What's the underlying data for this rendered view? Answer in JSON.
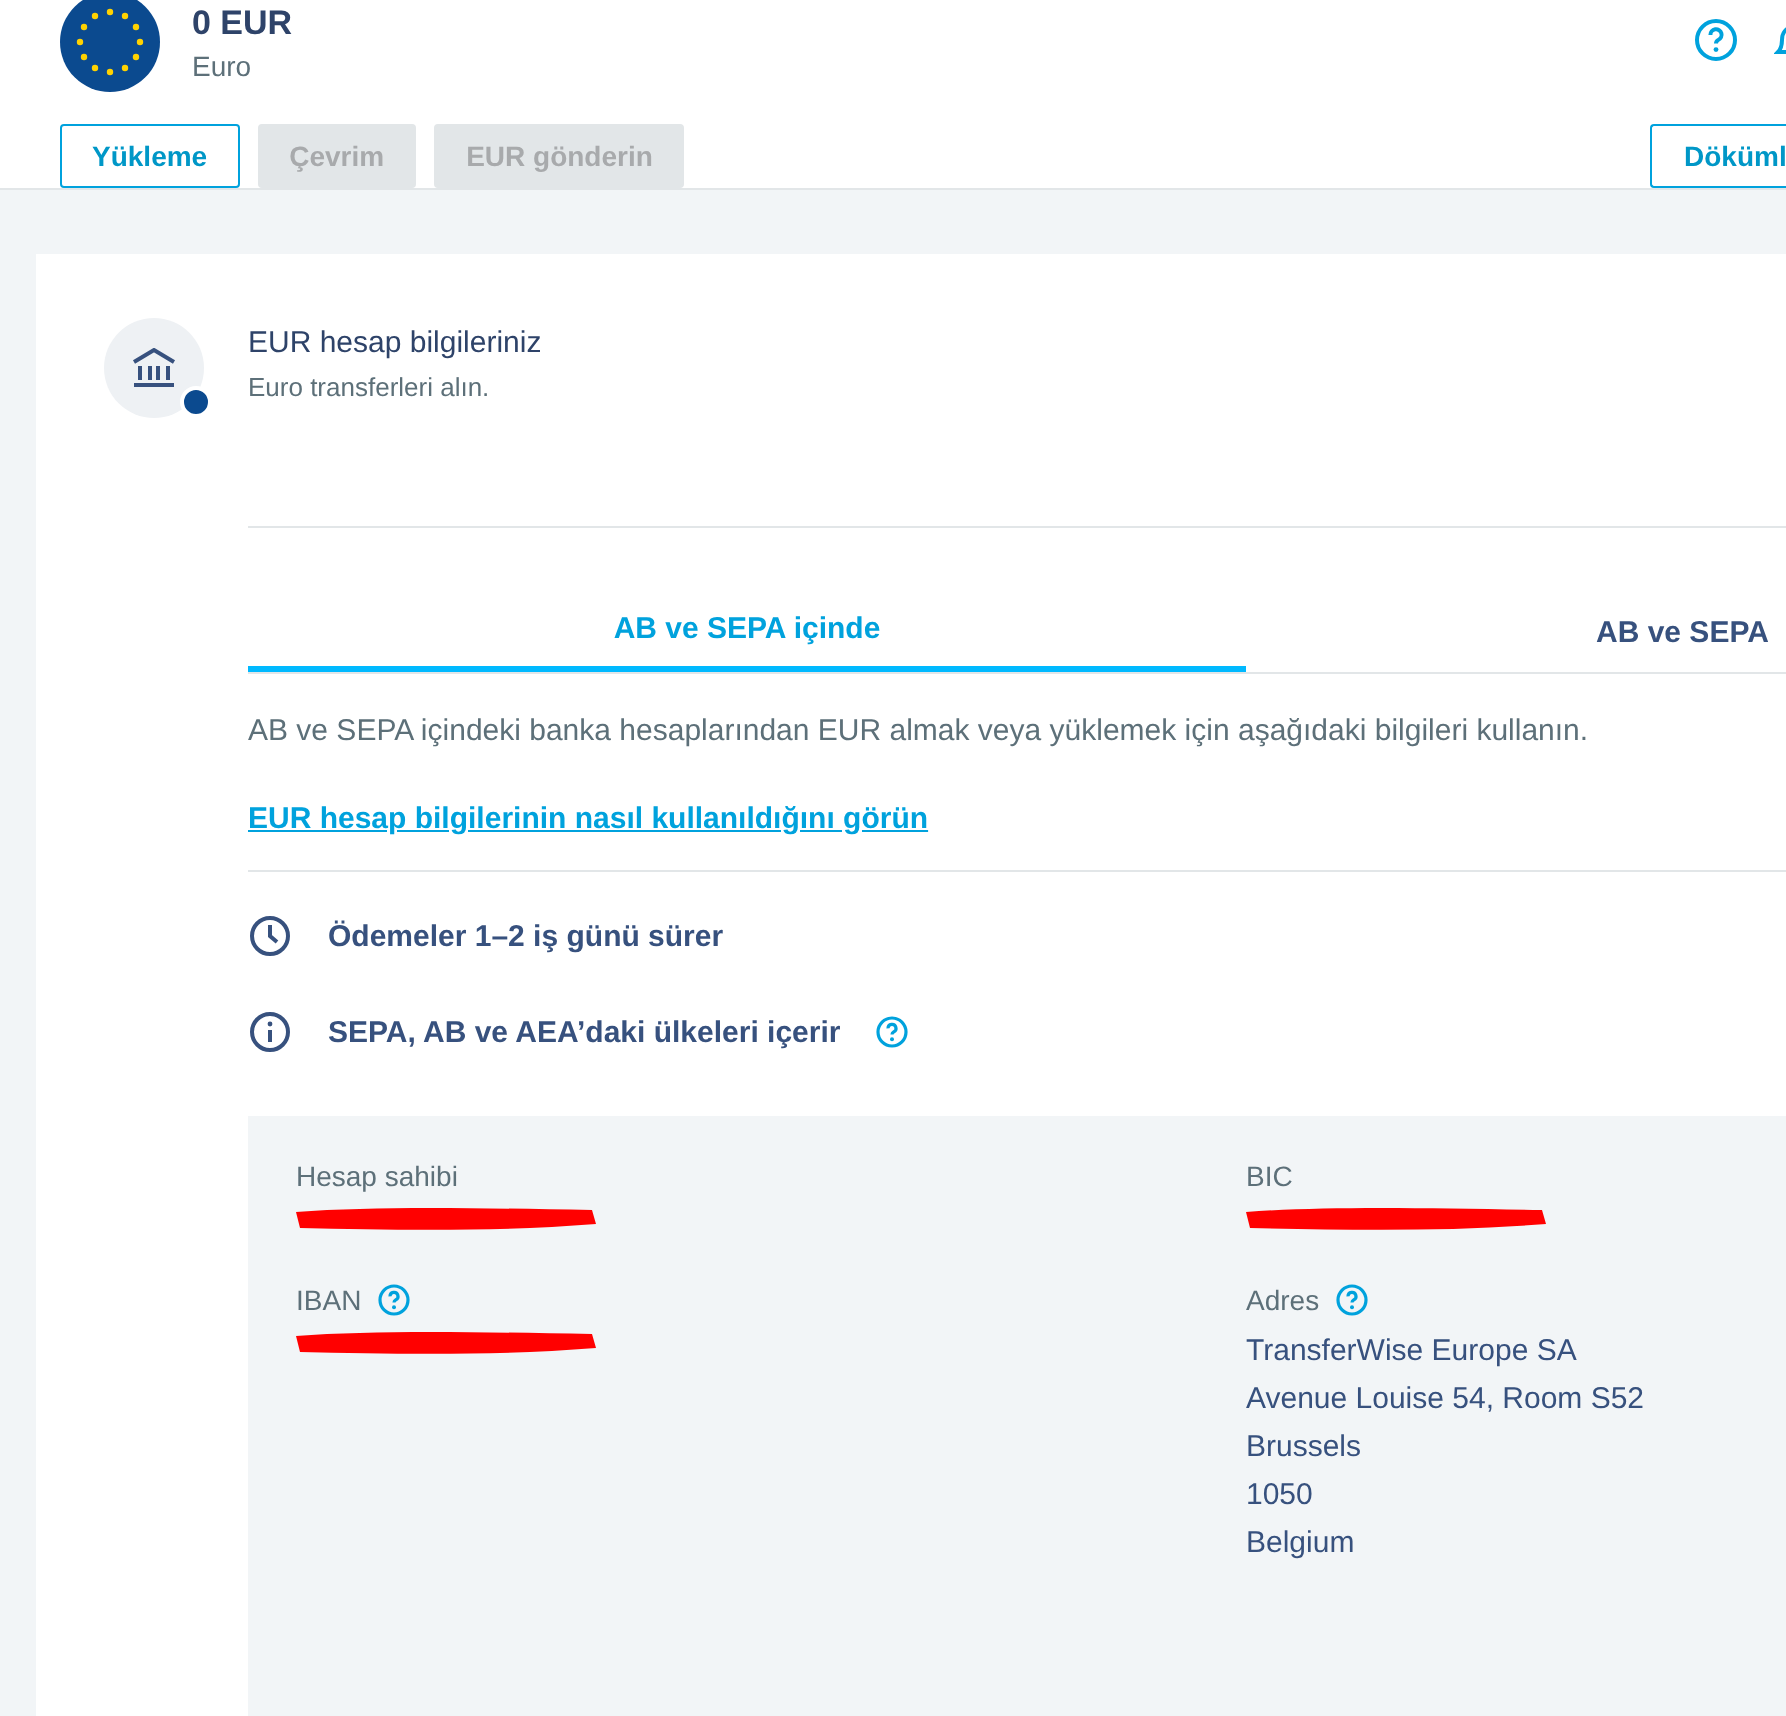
{
  "balance": {
    "amount": "0 EUR",
    "currency": "Euro"
  },
  "actions": [
    {
      "label": "Yükleme",
      "disabled": false
    },
    {
      "label": "Çevrim",
      "disabled": true
    },
    {
      "label": "EUR gönderin",
      "disabled": true
    }
  ],
  "statement_button": "Döküml",
  "account_card": {
    "title": "EUR hesap bilgileriniz",
    "subtitle": "Euro transferleri alın."
  },
  "tabs": [
    {
      "label": "AB ve SEPA içinde",
      "selected": true
    },
    {
      "label": "AB ve SEPA",
      "selected": false
    }
  ],
  "description": "AB ve SEPA içindeki banka hesaplarından EUR almak veya yüklemek için aşağıdaki bilgileri kullanın.",
  "help_link": "EUR hesap bilgilerinin nasıl kullanıldığını görün",
  "facts": [
    {
      "kind": "clock",
      "text": "Ödemeler 1–2 iş günü sürer",
      "help": false
    },
    {
      "kind": "info",
      "text": "SEPA, AB ve AEA’daki ülkeleri içerir",
      "help": true
    }
  ],
  "details": [
    {
      "label": "Hesap sahibi",
      "help": false,
      "redacted": true
    },
    {
      "label": "BIC",
      "help": false,
      "redacted": true
    },
    {
      "label": "IBAN",
      "help": true,
      "redacted": true
    },
    {
      "label": "Adres",
      "help": true,
      "redacted": false,
      "lines": [
        "TransferWise Europe SA",
        "Avenue Louise 54, Room S52",
        "Brussels",
        "1050",
        "Belgium"
      ]
    }
  ]
}
